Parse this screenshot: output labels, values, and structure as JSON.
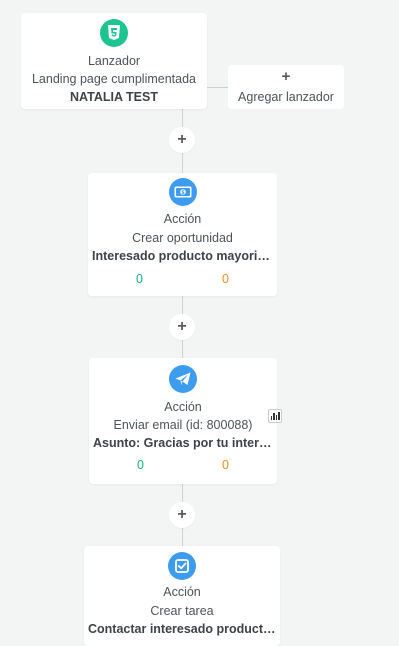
{
  "colors": {
    "green": "#1cc58f",
    "blue": "#3d9bf0",
    "zero_green": "#17b27a",
    "zero_orange": "#f28c28",
    "background": "#f3f4f4"
  },
  "trigger": {
    "icon": "html5-icon",
    "type": "Lanzador",
    "description": "Landing page cumplimentada",
    "name": "NATALIA TEST"
  },
  "add_trigger": {
    "icon": "plus-icon",
    "label": "Agregar lanzador"
  },
  "add_step_symbol": "+",
  "actions": [
    {
      "icon": "money-bill-icon",
      "type": "Acción",
      "description": "Crear oportunidad",
      "name": "Interesado producto mayorista",
      "count_green": "0",
      "count_orange": "0"
    },
    {
      "icon": "paper-plane-icon",
      "type": "Acción",
      "description": "Enviar email (id: 800088)",
      "name": "Asunto: Gracias por tu intere...",
      "count_green": "0",
      "count_orange": "0",
      "stats_icon": "bar-chart-icon"
    },
    {
      "icon": "check-square-icon",
      "type": "Acción",
      "description": "Crear tarea",
      "name": "Contactar interesado producto..."
    }
  ]
}
